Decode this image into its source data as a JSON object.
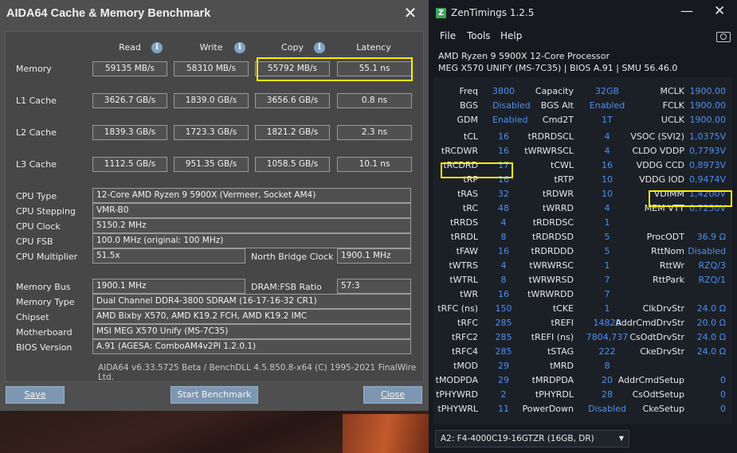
{
  "aida": {
    "title": "AIDA64 Cache & Memory Benchmark",
    "close_glyph": "✕",
    "columns": [
      "Read",
      "Write",
      "Copy",
      "Latency"
    ],
    "info_glyph": "i",
    "rows": [
      {
        "label": "Memory",
        "values": [
          "59135 MB/s",
          "58310 MB/s",
          "55792 MB/s",
          "55.1 ns"
        ]
      },
      {
        "label": "L1 Cache",
        "values": [
          "3626.7 GB/s",
          "1839.0 GB/s",
          "3656.6 GB/s",
          "0.8 ns"
        ]
      },
      {
        "label": "L2 Cache",
        "values": [
          "1839.3 GB/s",
          "1723.3 GB/s",
          "1821.2 GB/s",
          "2.3 ns"
        ]
      },
      {
        "label": "L3 Cache",
        "values": [
          "1112.5 GB/s",
          "951.35 GB/s",
          "1058.5 GB/s",
          "10.1 ns"
        ]
      }
    ],
    "info": {
      "cpu_type_label": "CPU Type",
      "cpu_type": "12-Core AMD Ryzen 9 5900X  (Vermeer, Socket AM4)",
      "cpu_stepping_label": "CPU Stepping",
      "cpu_stepping": "VMR-B0",
      "cpu_clock_label": "CPU Clock",
      "cpu_clock": "5150.2 MHz",
      "cpu_fsb_label": "CPU FSB",
      "cpu_fsb": "100.0 MHz  (original: 100 MHz)",
      "cpu_mult_label": "CPU Multiplier",
      "cpu_mult": "51.5x",
      "nb_clock_label": "North Bridge Clock",
      "nb_clock": "1900.1 MHz",
      "mem_bus_label": "Memory Bus",
      "mem_bus": "1900.1 MHz",
      "dram_fsb_label": "DRAM:FSB Ratio",
      "dram_fsb": "57:3",
      "mem_type_label": "Memory Type",
      "mem_type": "Dual Channel DDR4-3800 SDRAM  (16-17-16-32 CR1)",
      "chipset_label": "Chipset",
      "chipset": "AMD Bixby X570, AMD K19.2 FCH, AMD K19.2 IMC",
      "mobo_label": "Motherboard",
      "mobo": "MSI MEG X570 Unify (MS-7C35)",
      "bios_label": "BIOS Version",
      "bios": "A.91  (AGESA: ComboAM4v2PI 1.2.0.1)"
    },
    "footer": "AIDA64 v6.33.5725 Beta / BenchDLL 4.5.850.8-x64  (C) 1995-2021 FinalWire Ltd.",
    "buttons": {
      "save": "Save",
      "start": "Start Benchmark",
      "close": "Close"
    }
  },
  "zen": {
    "logo": "Z",
    "title": "ZenTimings 1.2.5",
    "min_glyph": "—",
    "close_glyph": "✕",
    "menu": [
      "File",
      "Tools",
      "Help"
    ],
    "cpu": "AMD Ryzen 9 5900X 12-Core Processor",
    "board": "MEG X570 UNIFY (MS-7C35) | BIOS A.91 | SMU 56.46.0",
    "top": [
      [
        "Freq",
        "3800",
        "Capacity",
        "32GB",
        "MCLK",
        "1900.00"
      ],
      [
        "BGS",
        "Disabled",
        "BGS Alt",
        "Enabled",
        "FCLK",
        "1900.00"
      ],
      [
        "GDM",
        "Enabled",
        "Cmd2T",
        "1T",
        "UCLK",
        "1900.00"
      ]
    ],
    "timings": [
      [
        "tCL",
        "16",
        "tRDRDSCL",
        "4",
        "VSOC (SVI2)",
        "1,0375V"
      ],
      [
        "tRCDWR",
        "16",
        "tWRWRSCL",
        "4",
        "CLDO VDDP",
        "0,7793V"
      ],
      [
        "tRCDRD",
        "17",
        "tCWL",
        "16",
        "VDDG CCD",
        "0,8973V"
      ],
      [
        "tRP",
        "16",
        "tRTP",
        "10",
        "VDDG IOD",
        "0,9474V"
      ],
      [
        "tRAS",
        "32",
        "tRDWR",
        "10",
        "VDIMM",
        "1,4200V"
      ],
      [
        "tRC",
        "48",
        "tWRRD",
        "4",
        "MEM VTT",
        "0,7250V"
      ],
      [
        "tRRDS",
        "4",
        "tRDRDSC",
        "1",
        "",
        ""
      ],
      [
        "tRRDL",
        "8",
        "tRDRDSD",
        "5",
        "ProcODT",
        "36.9 Ω"
      ],
      [
        "tFAW",
        "16",
        "tRDRDDD",
        "5",
        "RttNom",
        "Disabled"
      ],
      [
        "tWTRS",
        "4",
        "tWRWRSC",
        "1",
        "RttWr",
        "RZQ/3"
      ],
      [
        "tWTRL",
        "8",
        "tWRWRSD",
        "7",
        "RttPark",
        "RZQ/1"
      ],
      [
        "tWR",
        "16",
        "tWRWRDD",
        "7",
        "",
        ""
      ],
      [
        "tRFC (ns)",
        "150",
        "tCKE",
        "1",
        "ClkDrvStr",
        "24.0 Ω"
      ],
      [
        "tRFC",
        "285",
        "tREFI",
        "14829",
        "AddrCmdDrvStr",
        "20.0 Ω"
      ],
      [
        "tRFC2",
        "285",
        "tREFI (ns)",
        "7804,737",
        "CsOdtDrvStr",
        "24.0 Ω"
      ],
      [
        "tRFC4",
        "285",
        "tSTAG",
        "222",
        "CkeDrvStr",
        "24.0 Ω"
      ],
      [
        "tMOD",
        "29",
        "tMRD",
        "8",
        "",
        ""
      ],
      [
        "tMODPDA",
        "29",
        "tMRDPDA",
        "20",
        "AddrCmdSetup",
        "0"
      ],
      [
        "tPHYWRD",
        "2",
        "tPHYRDL",
        "28",
        "CsOdtSetup",
        "0"
      ],
      [
        "tPHYWRL",
        "11",
        "PowerDown",
        "Disabled",
        "CkeSetup",
        "0"
      ]
    ],
    "module": "A2: F4-4000C19-16GTZR (16GB, DR)",
    "module_arrow": "▼"
  }
}
